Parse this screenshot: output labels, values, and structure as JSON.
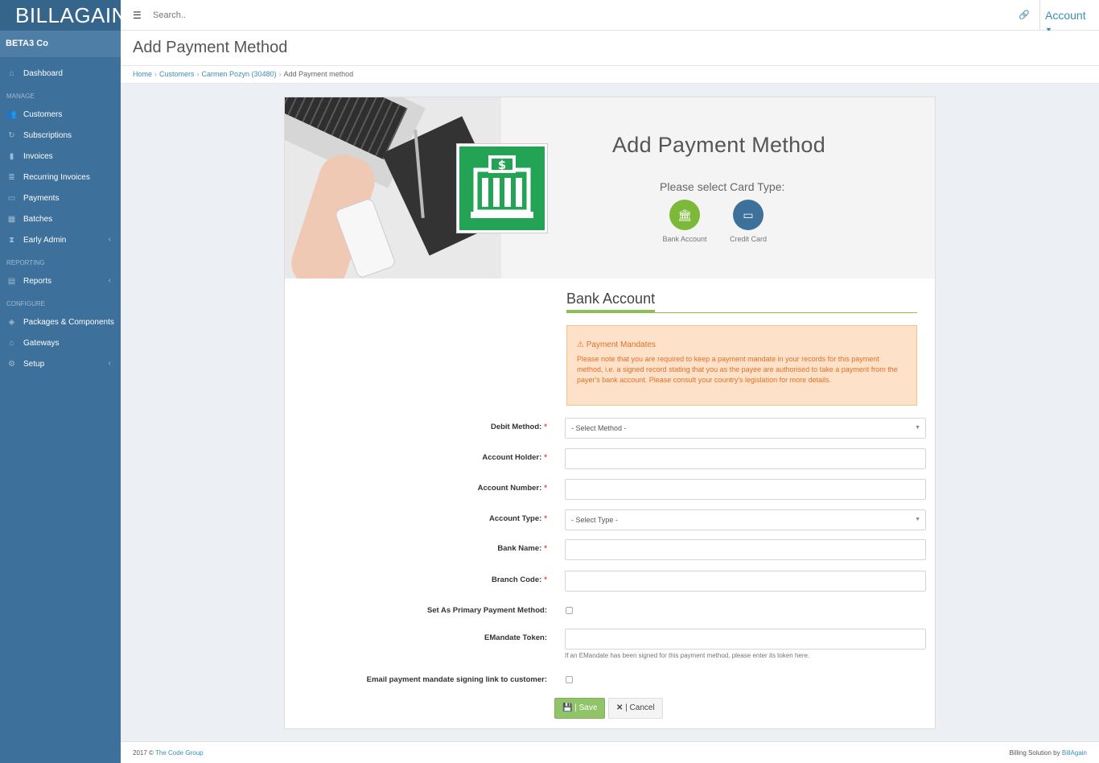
{
  "app": {
    "logo_text": "BILLAGAIN",
    "company": "BETA3 Co"
  },
  "sidebar": {
    "items": [
      {
        "label": "Dashboard",
        "icon": "home-icon"
      },
      {
        "header": "MANAGE"
      },
      {
        "label": "Customers",
        "icon": "users-icon"
      },
      {
        "label": "Subscriptions",
        "icon": "refresh-icon"
      },
      {
        "label": "Invoices",
        "icon": "file-icon"
      },
      {
        "label": "Recurring Invoices",
        "icon": "list-icon"
      },
      {
        "label": "Payments",
        "icon": "money-icon"
      },
      {
        "label": "Batches",
        "icon": "table-icon"
      },
      {
        "label": "Early Admin",
        "icon": "hourglass-icon",
        "chevron": true
      },
      {
        "header": "REPORTING"
      },
      {
        "label": "Reports",
        "icon": "clipboard-icon",
        "chevron": true
      },
      {
        "header": "CONFIGURE"
      },
      {
        "label": "Packages & Components",
        "icon": "tags-icon"
      },
      {
        "label": "Gateways",
        "icon": "bank-icon"
      },
      {
        "label": "Setup",
        "icon": "gear-icon",
        "chevron": true
      }
    ]
  },
  "topbar": {
    "search_placeholder": "Search..",
    "account_label": "Account"
  },
  "page": {
    "title": "Add Payment Method"
  },
  "breadcrumb": {
    "home": "Home",
    "customers": "Customers",
    "customer": "Carmen Pozyn (30480)",
    "current": "Add Payment method"
  },
  "hero": {
    "title": "Add Payment Method",
    "prompt": "Please select Card Type:",
    "types": [
      {
        "label": "Bank Account",
        "color": "#7cb83a",
        "icon": "bank-icon"
      },
      {
        "label": "Credit Card",
        "color": "#3d709b",
        "icon": "credit-card-icon"
      }
    ]
  },
  "section": {
    "title": "Bank Account"
  },
  "alert": {
    "title": "Payment Mandates",
    "text": "Please note that you are required to keep a payment mandate in your records for this payment method, i.e. a signed record stating that you as the payee are authorised to take a payment from the payer's bank account. Please consult your country's legislation for more details."
  },
  "form": {
    "debit_method": {
      "label": "Debit Method:",
      "value": "- Select Method -"
    },
    "account_holder": {
      "label": "Account Holder:"
    },
    "account_number": {
      "label": "Account Number:"
    },
    "account_type": {
      "label": "Account Type:",
      "value": "- Select Type -"
    },
    "bank_name": {
      "label": "Bank Name:"
    },
    "branch_code": {
      "label": "Branch Code:"
    },
    "primary": {
      "label": "Set As Primary Payment Method:"
    },
    "emandate": {
      "label": "EMandate Token:",
      "help": "If an EMandate has been signed for this payment method, please enter its token here."
    },
    "email_link": {
      "label": "Email payment mandate signing link to customer:"
    },
    "required_mark": "*",
    "save_label": "| Save",
    "cancel_label": "| Cancel"
  },
  "footer": {
    "copyright": "2017 ©",
    "company": "The Code Group",
    "right_text": "Billing Solution by",
    "right_link": "BillAgain"
  }
}
